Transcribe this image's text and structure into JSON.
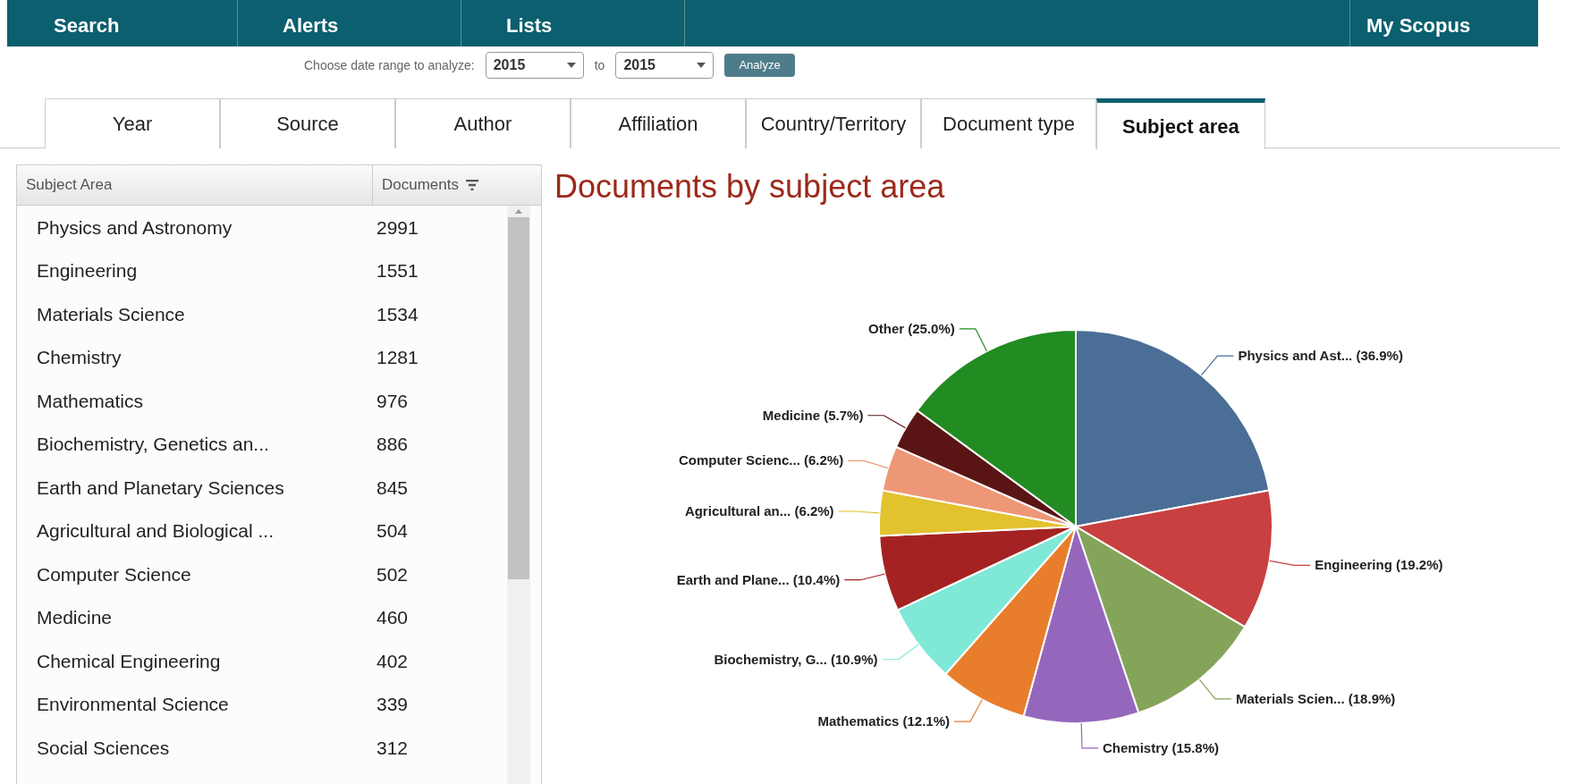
{
  "nav": {
    "left_items": [
      "Search",
      "Alerts",
      "Lists"
    ],
    "right_item": "My Scopus"
  },
  "date_range": {
    "prompt": "Choose date range to analyze:",
    "from": "2015",
    "separator": "to",
    "to": "2015",
    "button": "Analyze"
  },
  "tabs": [
    {
      "label": "Year",
      "selected": false
    },
    {
      "label": "Source",
      "selected": false
    },
    {
      "label": "Author",
      "selected": false
    },
    {
      "label": "Affiliation",
      "selected": false
    },
    {
      "label": "Country/Territory",
      "selected": false
    },
    {
      "label": "Document type",
      "selected": false
    },
    {
      "label": "Subject area",
      "selected": true
    }
  ],
  "table": {
    "columns": [
      "Subject Area",
      "Documents"
    ],
    "rows": [
      {
        "name": "Physics and Astronomy",
        "count": "2991"
      },
      {
        "name": "Engineering",
        "count": "1551"
      },
      {
        "name": "Materials Science",
        "count": "1534"
      },
      {
        "name": "Chemistry",
        "count": "1281"
      },
      {
        "name": "Mathematics",
        "count": "976"
      },
      {
        "name": "Biochemistry, Genetics an...",
        "count": "886"
      },
      {
        "name": "Earth and Planetary Sciences",
        "count": "845"
      },
      {
        "name": "Agricultural and Biological ...",
        "count": "504"
      },
      {
        "name": "Computer Science",
        "count": "502"
      },
      {
        "name": "Medicine",
        "count": "460"
      },
      {
        "name": "Chemical Engineering",
        "count": "402"
      },
      {
        "name": "Environmental Science",
        "count": "339"
      },
      {
        "name": "Social Sciences",
        "count": "312"
      }
    ]
  },
  "chart": {
    "chart_data": {
      "type": "pie",
      "title": "Documents by subject area",
      "categories": [
        "Physics and Ast...",
        "Engineering",
        "Materials Scien...",
        "Chemistry",
        "Mathematics",
        "Biochemistry, G...",
        "Earth and Plane...",
        "Agricultural an...",
        "Computer Scienc...",
        "Medicine",
        "Other"
      ],
      "values": [
        36.9,
        19.2,
        18.9,
        15.8,
        12.1,
        10.9,
        10.4,
        6.2,
        6.2,
        5.7,
        25.0
      ],
      "value_labels": [
        "(36.9%)",
        "(19.2%)",
        "(18.9%)",
        "(15.8%)",
        "(12.1%)",
        "(10.9%)",
        "(10.4%)",
        "(6.2%)",
        "(6.2%)",
        "(5.7%)",
        "(25.0%)"
      ],
      "colors": [
        "#4a6e96",
        "#c84040",
        "#84a45a",
        "#9467bd",
        "#e87e2c",
        "#7fe8d6",
        "#a52222",
        "#e2c22e",
        "#ee9777",
        "#5a1414",
        "#228b22"
      ]
    }
  }
}
